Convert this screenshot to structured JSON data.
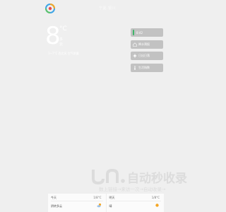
{
  "header": {
    "city": "宁夏·银川"
  },
  "current": {
    "temperature": "8",
    "unit": "°C",
    "condition": "多云",
    "details": "1~7°C   西北风   空气质量"
  },
  "side_buttons": [
    {
      "label": "8:42",
      "icon": "green-bar-icon"
    },
    {
      "label": "降水预报",
      "icon": "house-icon"
    },
    {
      "label": "日出日落",
      "icon": "sun-icon"
    },
    {
      "label": "生活指数",
      "icon": "thermometer-icon"
    }
  ],
  "watermark": {
    "main": "自动秒收录",
    "sub": "数上链接→来访一次→自动收录→"
  },
  "forecast": [
    {
      "day": "今天",
      "temp": "1/8°C",
      "condition": "阴转多云",
      "icon": "cloud-sun-icon"
    },
    {
      "day": "明天",
      "temp": "1/8°C",
      "condition": "晴",
      "icon": "sun-icon"
    }
  ],
  "colors": {
    "background": "#efefef",
    "button": "#c2c2c2",
    "accent_green": "#3fb56a",
    "sun": "#f5a623"
  }
}
